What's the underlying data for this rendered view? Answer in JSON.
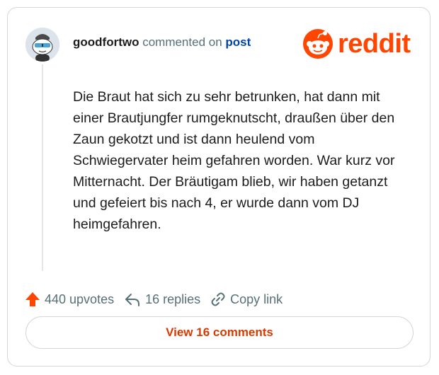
{
  "comment": {
    "username": "goodfortwo",
    "action_text": "commented on",
    "post_link": "post",
    "body": "Die Braut hat sich zu sehr betrunken, hat dann mit einer Brautjungfer rumgeknutscht, draußen über den Zaun gekotzt und ist dann heulend vom Schwiegervater heim gefahren worden. War kurz vor Mitternacht. Der Bräutigam blieb, wir haben getanzt und gefeiert bis nach 4, er wurde dann vom DJ heimgefahren."
  },
  "brand": {
    "name": "reddit",
    "color": "#ff4500"
  },
  "actions": {
    "upvotes": "440 upvotes",
    "replies": "16 replies",
    "copy_link": "Copy link"
  },
  "view_comments_label": "View 16 comments",
  "icons": {
    "upvote": "upvote-arrow-icon",
    "reply": "reply-arrow-icon",
    "link": "link-icon",
    "logo": "reddit-snoo-icon"
  }
}
